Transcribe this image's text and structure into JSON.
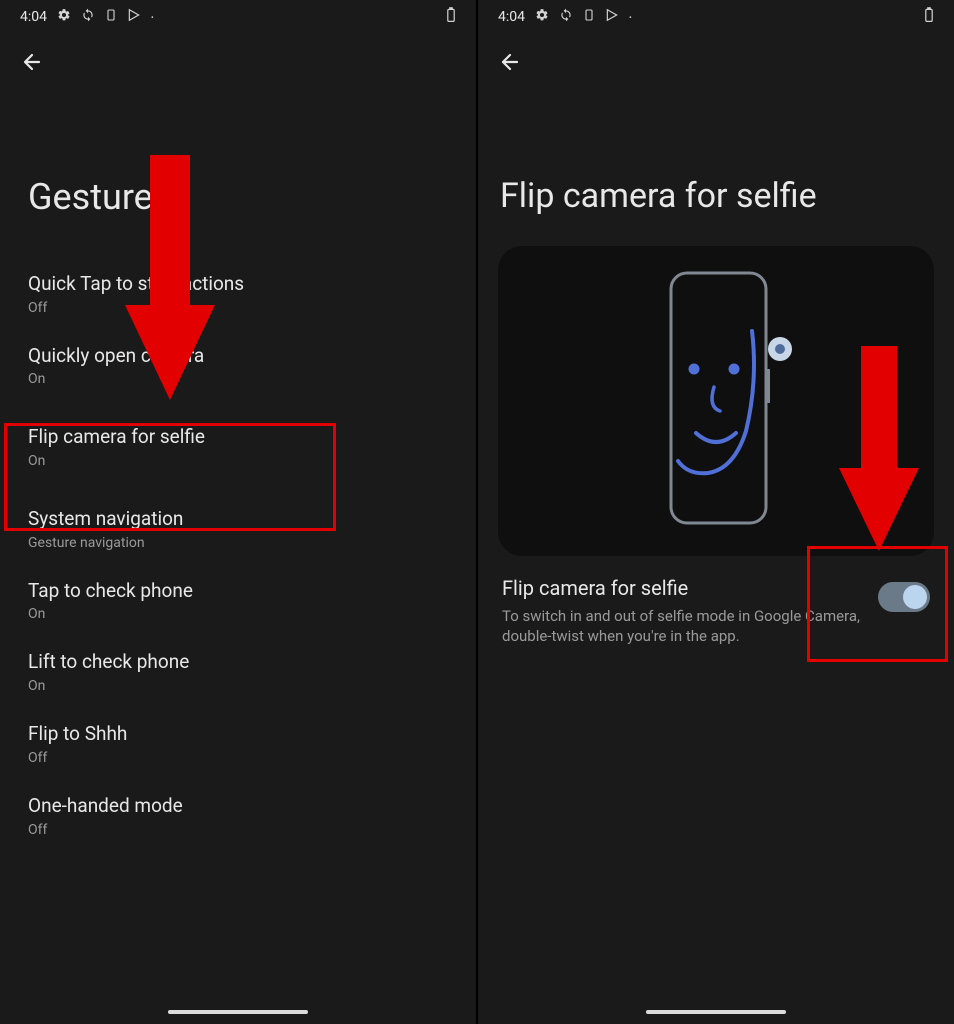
{
  "statusBar": {
    "time": "4:04",
    "batteryIcon": "battery-icon"
  },
  "left": {
    "title": "Gestures",
    "items": [
      {
        "title": "Quick Tap to start actions",
        "subtitle": "Off"
      },
      {
        "title": "Quickly open camera",
        "subtitle": "On"
      },
      {
        "title": "Flip camera for selfie",
        "subtitle": "On"
      },
      {
        "title": "System navigation",
        "subtitle": "Gesture navigation"
      },
      {
        "title": "Tap to check phone",
        "subtitle": "On"
      },
      {
        "title": "Lift to check phone",
        "subtitle": "On"
      },
      {
        "title": "Flip to Shhh",
        "subtitle": "Off"
      },
      {
        "title": "One-handed mode",
        "subtitle": "Off"
      }
    ]
  },
  "right": {
    "title": "Flip camera for selfie",
    "toggle": {
      "title": "Flip camera for selfie",
      "description": "To switch in and out of selfie mode in Google Camera, double-twist when you're in the app.",
      "state": "on"
    }
  },
  "accent": {
    "highlight": "#e20000"
  }
}
